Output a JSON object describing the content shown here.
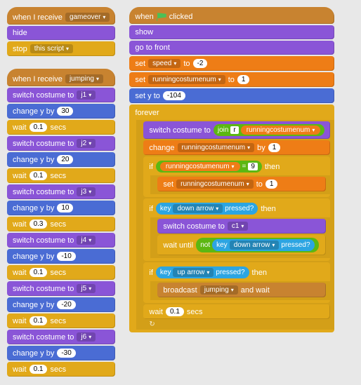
{
  "left": {
    "s1": {
      "hat_prefix": "when I receive",
      "hat_msg": "gameover",
      "hide": "hide",
      "stop": "stop",
      "stop_opt": "this script"
    },
    "s2": {
      "hat_prefix": "when I receive",
      "hat_msg": "jumping",
      "rows": [
        {
          "switch": "switch costume to",
          "cost": "j1",
          "chg": "change y by",
          "val": "30",
          "wait": "wait",
          "secs": "0.1",
          "suffix": "secs"
        },
        {
          "switch": "switch costume to",
          "cost": "j2",
          "chg": "change y by",
          "val": "20",
          "wait": "wait",
          "secs": "0.1",
          "suffix": "secs"
        },
        {
          "switch": "switch costume to",
          "cost": "j3",
          "chg": "change y by",
          "val": "10",
          "wait": "wait",
          "secs": "0.3",
          "suffix": "secs"
        },
        {
          "switch": "switch costume to",
          "cost": "j4",
          "chg": "change y by",
          "val": "-10",
          "wait": "wait",
          "secs": "0.1",
          "suffix": "secs"
        },
        {
          "switch": "switch costume to",
          "cost": "j5",
          "chg": "change y by",
          "val": "-20",
          "wait": "wait",
          "secs": "0.1",
          "suffix": "secs"
        },
        {
          "switch": "switch costume to",
          "cost": "j6",
          "chg": "change y by",
          "val": "-30",
          "wait": "wait",
          "secs": "0.1",
          "suffix": "secs"
        }
      ]
    }
  },
  "right": {
    "hat": "when",
    "hat_suffix": "clicked",
    "show": "show",
    "gofront": "go to front",
    "set": "set",
    "speed": "speed",
    "to": "to",
    "speed_val": "-2",
    "rcn": "runningcostumenum",
    "rcn_init": "1",
    "sety": "set y to",
    "yval": "-104",
    "forever": "forever",
    "switch": "switch costume to",
    "join": "join",
    "joinL": "r",
    "change": "change",
    "by": "by",
    "chg_val": "1",
    "if": "if",
    "then": "then",
    "eq_r": "9",
    "set_rcn_val": "1",
    "key": "key",
    "down": "down arrow",
    "up": "up arrow",
    "pressed": "pressed?",
    "c1": "c1",
    "waituntil": "wait until",
    "not": "not",
    "broadcast": "broadcast",
    "jumping": "jumping",
    "andwait": "and wait",
    "wait": "wait",
    "wsecs": "0.1",
    "secs": "secs"
  }
}
